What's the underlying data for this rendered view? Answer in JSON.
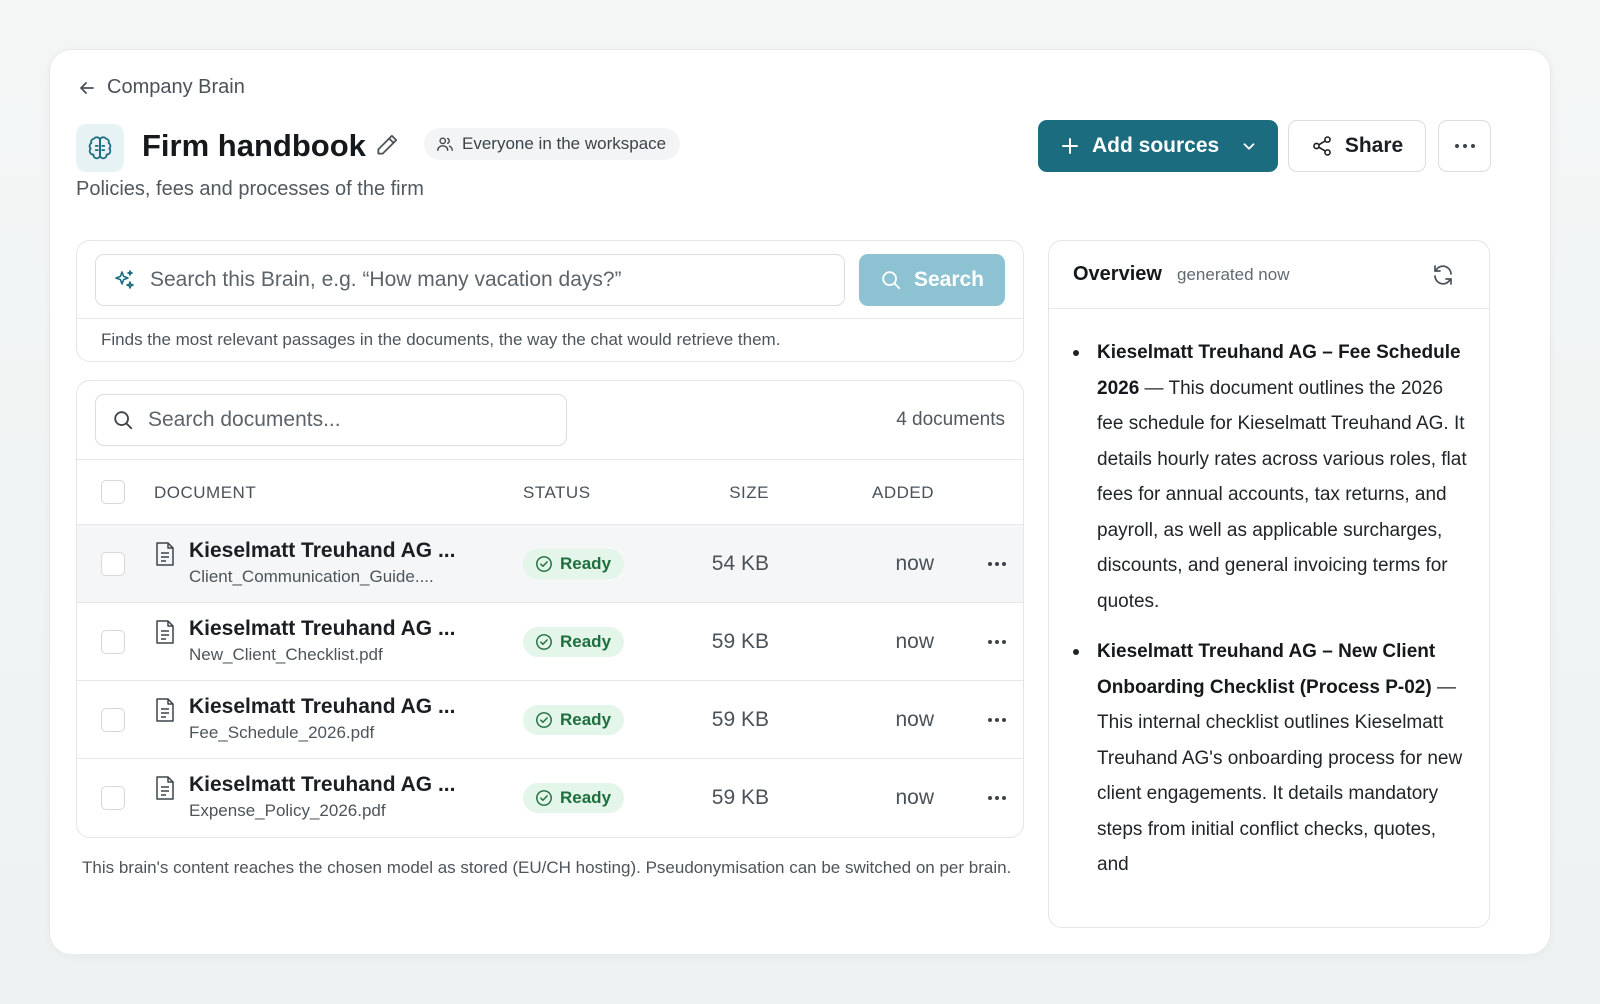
{
  "nav": {
    "back_label": "Company Brain"
  },
  "header": {
    "title": "Firm handbook",
    "audience": "Everyone in the workspace",
    "subtitle": "Policies, fees and processes of the firm"
  },
  "actions": {
    "add_sources": "Add sources",
    "share": "Share"
  },
  "brain_search": {
    "placeholder": "Search this Brain, e.g. “How many vacation days?”",
    "button": "Search",
    "hint": "Finds the most relevant passages in the documents, the way the chat would retrieve them."
  },
  "documents": {
    "search_placeholder": "Search documents...",
    "count": "4 documents",
    "columns": {
      "document": "DOCUMENT",
      "status": "STATUS",
      "size": "SIZE",
      "added": "ADDED"
    },
    "rows": [
      {
        "name": "Kieselmatt Treuhand AG ...",
        "file": "Client_Communication_Guide....",
        "status": "Ready",
        "size": "54 KB",
        "added": "now"
      },
      {
        "name": "Kieselmatt Treuhand AG ...",
        "file": "New_Client_Checklist.pdf",
        "status": "Ready",
        "size": "59 KB",
        "added": "now"
      },
      {
        "name": "Kieselmatt Treuhand AG ...",
        "file": "Fee_Schedule_2026.pdf",
        "status": "Ready",
        "size": "59 KB",
        "added": "now"
      },
      {
        "name": "Kieselmatt Treuhand AG ...",
        "file": "Expense_Policy_2026.pdf",
        "status": "Ready",
        "size": "59 KB",
        "added": "now"
      }
    ]
  },
  "footer_note": "This brain's content reaches the chosen model as stored (EU/CH hosting). Pseudonymisation can be switched on per brain.",
  "overview": {
    "title": "Overview",
    "generated": "generated now",
    "items": [
      {
        "heading": "Kieselmatt Treuhand AG – Fee Schedule 2026",
        "text": " — This document outlines the 2026 fee schedule for Kieselmatt Treuhand AG. It details hourly rates across various roles, flat fees for annual accounts, tax returns, and payroll, as well as applicable surcharges, discounts, and general invoicing terms for quotes."
      },
      {
        "heading": "Kieselmatt Treuhand AG – New Client Onboarding Checklist (Process P-02)",
        "text": " — This internal checklist outlines Kieselmatt Treuhand AG's onboarding process for new client engagements. It details mandatory steps from initial conflict checks, quotes, and"
      }
    ]
  },
  "colors": {
    "accent": "#1c6c80",
    "search_button": "#8cc2d2",
    "ready_bg": "#e4f5ea",
    "ready_text": "#1f6f3e"
  }
}
